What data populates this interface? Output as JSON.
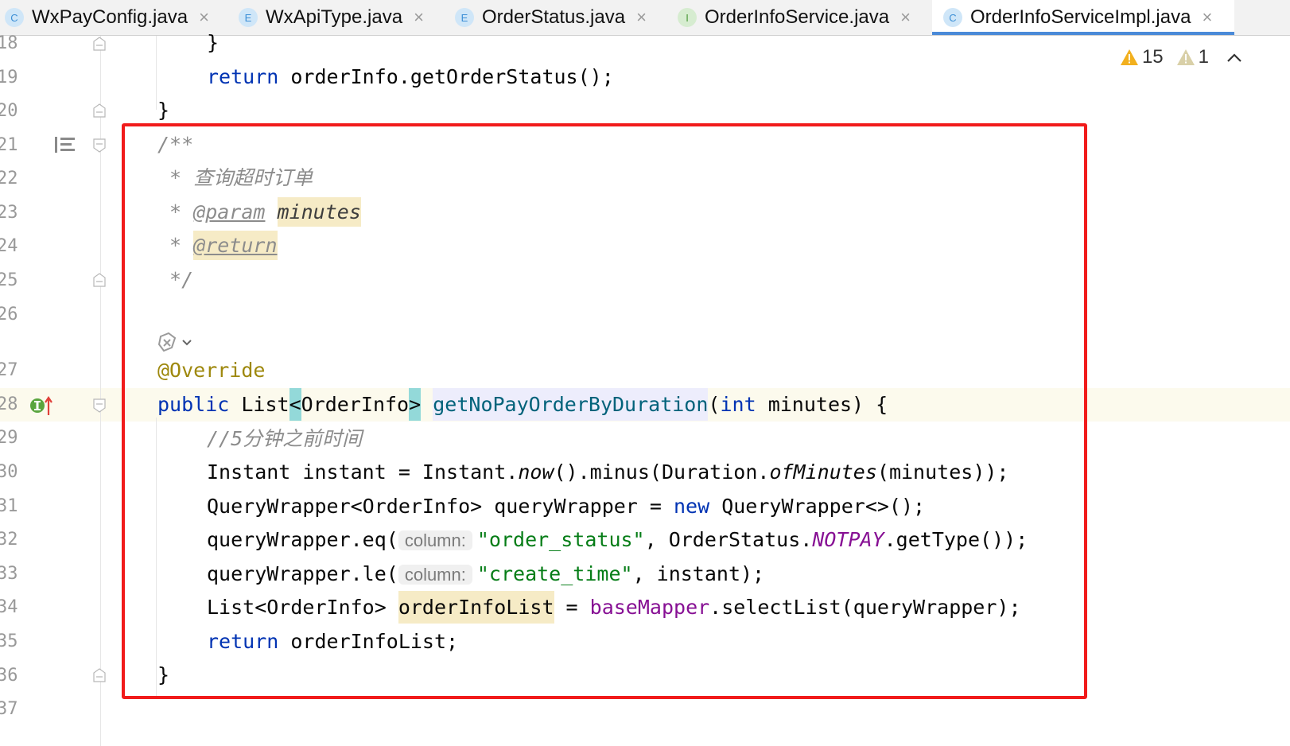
{
  "tabs": [
    {
      "badge": "C",
      "badge_color": "#3d8fd6",
      "badge_bg": "#cfe6f8",
      "label": "WxPayConfig.java"
    },
    {
      "badge": "E",
      "badge_color": "#3d8fd6",
      "badge_bg": "#cfe6f8",
      "label": "WxApiType.java"
    },
    {
      "badge": "E",
      "badge_color": "#3d8fd6",
      "badge_bg": "#cfe6f8",
      "label": "OrderStatus.java"
    },
    {
      "badge": "I",
      "badge_color": "#4b9a3a",
      "badge_bg": "#d6ecd0",
      "label": "OrderInfoService.java"
    },
    {
      "badge": "C",
      "badge_color": "#3d8fd6",
      "badge_bg": "#cfe6f8",
      "label": "OrderInfoServiceImpl.java",
      "active": true
    }
  ],
  "close_glyph": "×",
  "inspections": {
    "warnings": "15",
    "weak_warnings": "1"
  },
  "line_numbers": [
    "18",
    "19",
    "20",
    "21",
    "22",
    "23",
    "24",
    "25",
    "26",
    "27",
    "28",
    "29",
    "30",
    "31",
    "32",
    "33",
    "34",
    "35",
    "36",
    "37"
  ],
  "code": {
    "l18": "}",
    "l19_kw": "return",
    "l19_rest": " orderInfo.getOrderStatus();",
    "l20": "}",
    "l21": "/**",
    "l22": " * 查询超时订单",
    "l23_star": " * ",
    "l23_tag": "@param",
    "l23_name": "minutes",
    "l24_star": " * ",
    "l24_tag": "@return",
    "l25": " */",
    "l27": "@Override",
    "l28_public": "public",
    "l28_list": " List",
    "l28_generic_open": "<",
    "l28_generic_type": "OrderInfo",
    "l28_generic_close": ">",
    "l28_method": "getNoPayOrderByDuration",
    "l28_paren": "(",
    "l28_int": "int",
    "l28_rest": " minutes) {",
    "l29": "//5分钟之前时间",
    "l30_a": "Instant instant = Instant.",
    "l30_now": "now",
    "l30_b": "().minus(Duration.",
    "l30_ofm": "ofMinutes",
    "l30_c": "(minutes));",
    "l31_a": "QueryWrapper<OrderInfo> queryWrapper = ",
    "l31_new": "new",
    "l31_b": " QueryWrapper<>();",
    "l32_a": "queryWrapper.eq(",
    "l32_hint": "column:",
    "l32_str": "\"order_status\"",
    "l32_b": ", OrderStatus.",
    "l32_const": "NOTPAY",
    "l32_c": ".getType());",
    "l33_a": "queryWrapper.le(",
    "l33_hint": "column:",
    "l33_str": "\"create_time\"",
    "l33_b": ", instant);",
    "l34_a": "List<OrderInfo> ",
    "l34_var": "orderInfoList",
    "l34_b": " = ",
    "l34_field": "baseMapper",
    "l34_c": ".selectList(queryWrapper);",
    "l35_kw": "return",
    "l35_rest": " orderInfoList;",
    "l36": "}"
  }
}
